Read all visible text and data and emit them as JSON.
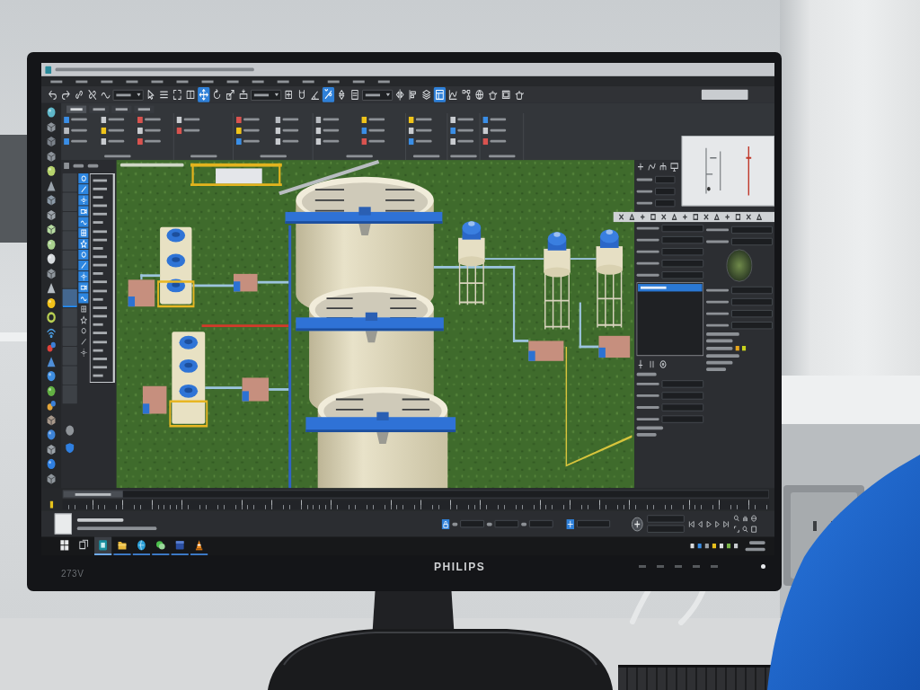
{
  "monitor": {
    "brand": "PHILIPS",
    "model": "273V"
  },
  "main_toolbar": [
    {
      "kind": "icon",
      "selected": false
    },
    {
      "kind": "icon",
      "selected": false
    },
    {
      "kind": "icon",
      "selected": false
    },
    {
      "kind": "icon",
      "selected": false
    },
    {
      "kind": "icon",
      "selected": false
    },
    {
      "kind": "dropdown",
      "selected": false
    },
    {
      "kind": "icon",
      "selected": false
    },
    {
      "kind": "icon",
      "selected": false
    },
    {
      "kind": "icon",
      "selected": false
    },
    {
      "kind": "icon",
      "selected": false
    },
    {
      "kind": "icon",
      "selected": true
    },
    {
      "kind": "icon",
      "selected": false
    },
    {
      "kind": "icon",
      "selected": false
    },
    {
      "kind": "icon",
      "selected": false
    },
    {
      "kind": "dropdown",
      "selected": false
    },
    {
      "kind": "icon",
      "selected": false
    },
    {
      "kind": "icon",
      "selected": false
    },
    {
      "kind": "icon",
      "selected": false
    },
    {
      "kind": "icon",
      "selected": true
    },
    {
      "kind": "icon",
      "selected": false
    },
    {
      "kind": "icon",
      "selected": false
    },
    {
      "kind": "dropdown",
      "selected": false
    },
    {
      "kind": "icon",
      "selected": false
    },
    {
      "kind": "icon",
      "selected": false
    },
    {
      "kind": "icon",
      "selected": false
    },
    {
      "kind": "icon",
      "selected": true
    },
    {
      "kind": "icon",
      "selected": false
    },
    {
      "kind": "icon",
      "selected": false
    },
    {
      "kind": "icon",
      "selected": false
    },
    {
      "kind": "icon",
      "selected": false
    },
    {
      "kind": "icon",
      "selected": false
    },
    {
      "kind": "icon",
      "selected": false
    }
  ],
  "ribbon": {
    "tabs": [
      {
        "selected": true
      },
      {
        "selected": false
      },
      {
        "selected": false
      },
      {
        "selected": false
      }
    ]
  },
  "scene_explorer": {
    "layers": [
      {
        "selected": false
      },
      {
        "selected": false
      },
      {
        "selected": false
      },
      {
        "selected": false
      },
      {
        "selected": false
      },
      {
        "selected": false
      },
      {
        "selected": true
      },
      {
        "selected": false
      },
      {
        "selected": false
      },
      {
        "selected": false
      },
      {
        "selected": false
      },
      {
        "selected": false
      }
    ],
    "filters": [
      {
        "on": true
      },
      {
        "on": true
      },
      {
        "on": true
      },
      {
        "on": true
      },
      {
        "on": true
      },
      {
        "on": true
      },
      {
        "on": true
      },
      {
        "on": true
      },
      {
        "on": true
      },
      {
        "on": true
      },
      {
        "on": true
      },
      {
        "on": true
      },
      {
        "on": false
      },
      {
        "on": false
      },
      {
        "on": false
      },
      {
        "on": false
      },
      {
        "on": false
      }
    ]
  },
  "command_panel": {
    "list": [
      {
        "selected": true
      }
    ]
  },
  "time_slider": {
    "level": 0
  },
  "taskbar": {
    "apps": [
      {
        "selected": true
      },
      {
        "selected": false
      },
      {
        "selected": false
      },
      {
        "selected": false
      },
      {
        "selected": false
      },
      {
        "selected": false
      }
    ]
  }
}
